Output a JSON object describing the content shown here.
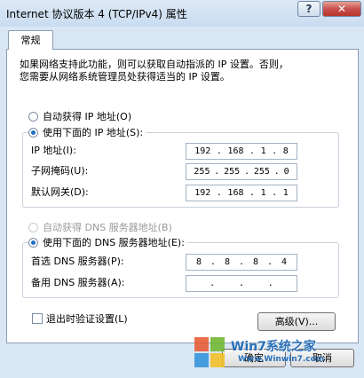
{
  "window": {
    "title": "Internet 协议版本 4 (TCP/IPv4) 属性",
    "help_glyph": "?",
    "close_glyph": "✕"
  },
  "tab": {
    "label": "常规"
  },
  "description": {
    "line1": "如果网络支持此功能，则可以获取自动指派的 IP 设置。否则，",
    "line2": "您需要从网络系统管理员处获得适当的 IP 设置。"
  },
  "ip_mode": {
    "auto_label": "自动获得 IP 地址(O)",
    "manual_label": "使用下面的 IP 地址(S):",
    "selected": "manual"
  },
  "ip_fields": {
    "ip_label": "IP 地址(I):",
    "ip_value": [
      "192",
      "168",
      "1",
      "8"
    ],
    "mask_label": "子网掩码(U):",
    "mask_value": [
      "255",
      "255",
      "255",
      "0"
    ],
    "gateway_label": "默认网关(D):",
    "gateway_value": [
      "192",
      "168",
      "1",
      "1"
    ]
  },
  "dns_mode": {
    "auto_label": "自动获得 DNS 服务器地址(B)",
    "manual_label": "使用下面的 DNS 服务器地址(E):",
    "selected": "manual",
    "auto_disabled": true
  },
  "dns_fields": {
    "preferred_label": "首选 DNS 服务器(P):",
    "preferred_value": [
      "8",
      "8",
      "8",
      "4"
    ],
    "alternate_label": "备用 DNS 服务器(A):",
    "alternate_value": [
      "",
      "",
      "",
      ""
    ]
  },
  "validate_on_exit": {
    "label": "退出时验证设置(L)",
    "checked": false
  },
  "buttons": {
    "advanced": "高级(V)...",
    "ok": "确定",
    "cancel": "取消"
  },
  "watermark": {
    "text": "Win7系统之家",
    "url": "Www.Winwin7.com"
  },
  "colors": {
    "titlebar": "#c9dcf0",
    "frame": "#d9e6f4",
    "close_button": "#c75050",
    "radio_dot": "#1f6dc4"
  }
}
